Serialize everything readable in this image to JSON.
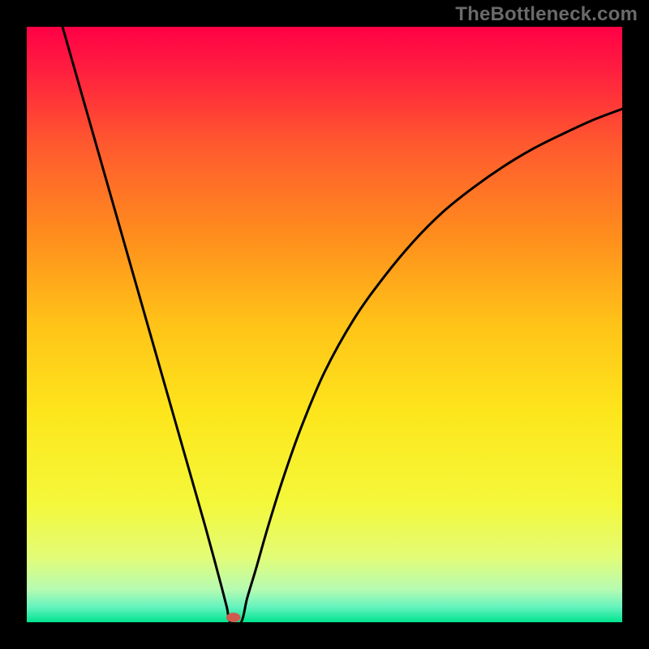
{
  "watermark": "TheBottleneck.com",
  "chart_data": {
    "type": "line",
    "title": "",
    "xlabel": "",
    "ylabel": "",
    "xlim": [
      0,
      1
    ],
    "ylim": [
      0,
      1
    ],
    "gradient": {
      "stops": [
        {
          "pos": 0.0,
          "color": "#ff0046"
        },
        {
          "pos": 0.07,
          "color": "#ff1d3f"
        },
        {
          "pos": 0.2,
          "color": "#ff5a2e"
        },
        {
          "pos": 0.35,
          "color": "#ff8d1d"
        },
        {
          "pos": 0.5,
          "color": "#ffc318"
        },
        {
          "pos": 0.65,
          "color": "#fde61c"
        },
        {
          "pos": 0.8,
          "color": "#f4f83a"
        },
        {
          "pos": 0.89,
          "color": "#e3fc76"
        },
        {
          "pos": 0.945,
          "color": "#b6fbb2"
        },
        {
          "pos": 0.975,
          "color": "#63f3be"
        },
        {
          "pos": 1.0,
          "color": "#00e48f"
        }
      ]
    },
    "minimum_x": 0.342,
    "marker": {
      "x": 0.347,
      "y": 0.008,
      "rx": 0.012,
      "ry": 0.008,
      "color": "#d15a4f"
    },
    "series": [
      {
        "name": "bottleneck-curve",
        "x": [
          0.06,
          0.08,
          0.1,
          0.12,
          0.14,
          0.16,
          0.18,
          0.2,
          0.22,
          0.24,
          0.26,
          0.28,
          0.3,
          0.315,
          0.327,
          0.336,
          0.342,
          0.36,
          0.37,
          0.385,
          0.405,
          0.43,
          0.46,
          0.5,
          0.55,
          0.6,
          0.65,
          0.7,
          0.75,
          0.8,
          0.85,
          0.9,
          0.95,
          1.0
        ],
        "y": [
          1.0,
          0.93,
          0.86,
          0.79,
          0.72,
          0.65,
          0.58,
          0.51,
          0.44,
          0.37,
          0.3,
          0.23,
          0.16,
          0.105,
          0.06,
          0.025,
          0.0,
          0.0,
          0.04,
          0.09,
          0.16,
          0.24,
          0.325,
          0.42,
          0.51,
          0.58,
          0.64,
          0.69,
          0.73,
          0.765,
          0.795,
          0.82,
          0.843,
          0.862
        ]
      }
    ]
  }
}
